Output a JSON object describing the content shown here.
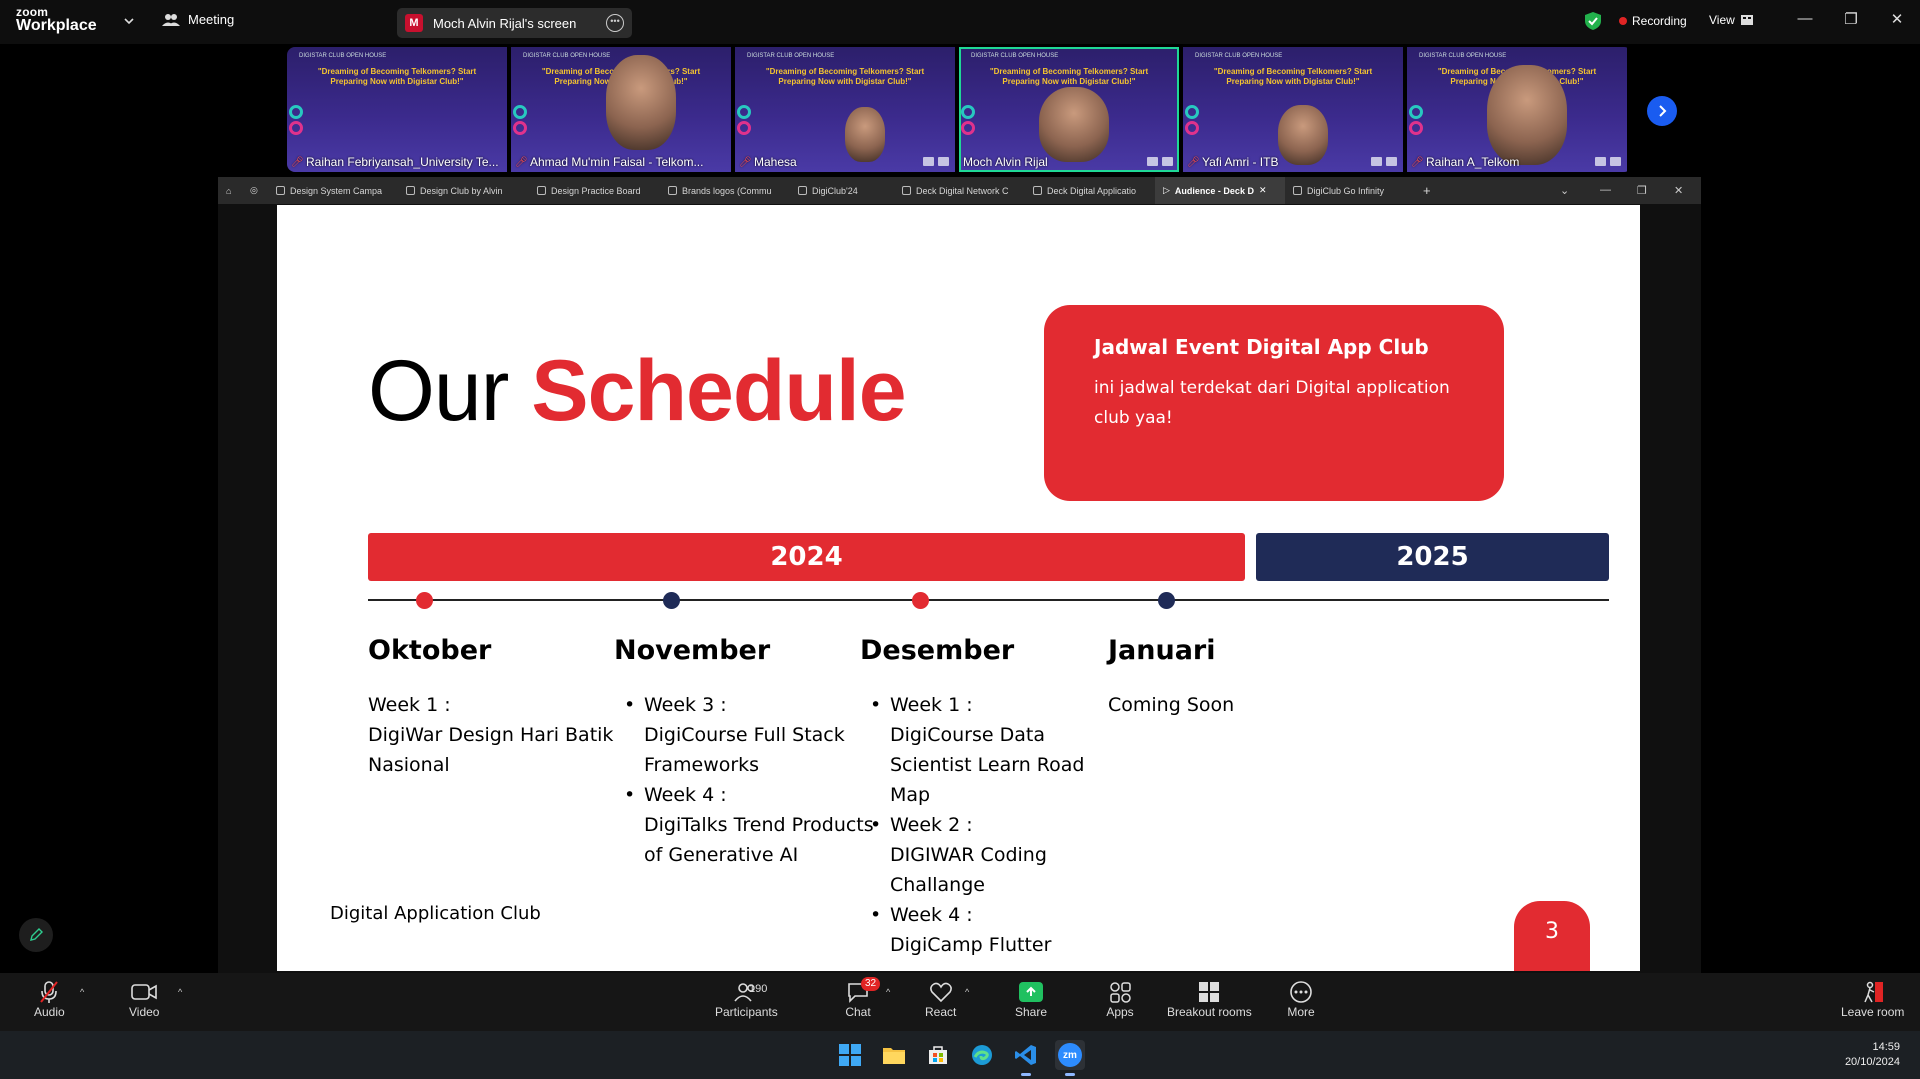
{
  "app": {
    "logo_line1": "zoom",
    "logo_line2": "Workplace",
    "meeting_label": "Meeting",
    "share_badge": "M",
    "share_label": "Moch Alvin Rijal's screen",
    "recording_label": "Recording",
    "view_label": "View"
  },
  "thumbnails": [
    {
      "name": "Raihan Febriyansah_University Te..."
    },
    {
      "name": "Ahmad Mu'min Faisal - Telkom..."
    },
    {
      "name": "Mahesa"
    },
    {
      "name": "Moch Alvin Rijal"
    },
    {
      "name": "Yafi Amri - ITB"
    },
    {
      "name": "Raihan A_Telkom"
    }
  ],
  "thumb_banner": {
    "header": "DIGISTAR CLUB OPEN HOUSE",
    "title": "\"Dreaming of Becoming Telkomers? Start Preparing Now with Digistar Club!\""
  },
  "browser_tabs": [
    {
      "label": "Design System Campa"
    },
    {
      "label": "Design Club by Alvin"
    },
    {
      "label": "Design Practice Board"
    },
    {
      "label": "Brands logos (Commu"
    },
    {
      "label": "DigiClub'24"
    },
    {
      "label": "Deck Digital Network C"
    },
    {
      "label": "Deck Digital Applicatio"
    },
    {
      "label": "Audience - Deck D"
    },
    {
      "label": "DigiClub Go Infinity"
    }
  ],
  "slide": {
    "title_plain": "Our",
    "title_accent": "Schedule",
    "card_title": "Jadwal Event Digital App Club",
    "card_text": "ini jadwal terdekat dari Digital application club yaa!",
    "year_1": "2024",
    "year_2": "2025",
    "columns": [
      {
        "month": "Oktober",
        "plain": [
          "Week 1 :",
          "DigiWar Design Hari Batik Nasional"
        ]
      },
      {
        "month": "November",
        "items": [
          "Week 3 :\nDigiCourse Full Stack Frameworks",
          "Week 4 :\nDigiTalks Trend Products of Generative AI"
        ]
      },
      {
        "month": "Desember",
        "items": [
          "Week 1 :\nDigiCourse Data Scientist Learn Road Map",
          "Week 2 :\nDIGIWAR Coding Challange",
          "Week 4 :\nDigiCamp Flutter"
        ]
      },
      {
        "month": "Januari",
        "plain": [
          "Coming Soon"
        ]
      }
    ],
    "footer": "Digital Application Club",
    "page_number": "3",
    "colors": {
      "accent": "#e22b31",
      "navy": "#1f2b57"
    }
  },
  "toolbar": {
    "audio": "Audio",
    "video": "Video",
    "participants": "Participants",
    "participants_count": "190",
    "chat": "Chat",
    "chat_badge": "32",
    "react": "React",
    "share": "Share",
    "apps": "Apps",
    "breakout": "Breakout rooms",
    "more": "More",
    "leave": "Leave room"
  },
  "taskbar": {
    "time": "14:59",
    "date": "20/10/2024",
    "zoom_label": "zm"
  }
}
